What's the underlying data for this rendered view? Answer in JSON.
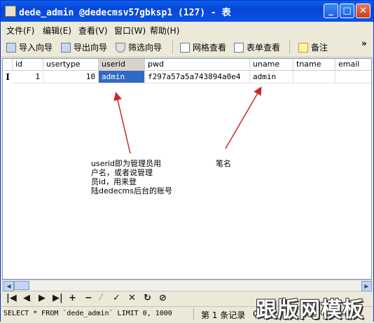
{
  "window": {
    "title": "dede_admin @dedecmsv57gbksp1 (127) - 表",
    "controls": [
      "minimize",
      "maximize",
      "close"
    ]
  },
  "menu": {
    "items": [
      "文件(F)",
      "编辑(E)",
      "查看(V)",
      "窗口(W)",
      "帮助(H)"
    ]
  },
  "toolbar": {
    "import_label": "导入向导",
    "export_label": "导出向导",
    "filter_label": "筛选向导",
    "grid_view_label": "网格查看",
    "form_view_label": "表单查看",
    "memo_label": "备注",
    "overflow": "»"
  },
  "grid": {
    "columns": [
      "id",
      "usertype",
      "userid",
      "pwd",
      "uname",
      "tname",
      "email"
    ],
    "selected_column": "userid",
    "row_indicator": "I",
    "rows": [
      {
        "id": "1",
        "usertype": "10",
        "userid": "admin",
        "pwd": "f297a57a5a743894a0e4",
        "uname": "admin",
        "tname": "",
        "email": ""
      }
    ]
  },
  "annotations": {
    "userid_note_lines": [
      "userid即为管理员用",
      "户名，或者说管理",
      "员id，用来登",
      "陆dedecms后台的账号"
    ],
    "uname_note": "笔名"
  },
  "navigation": {
    "buttons": [
      "first",
      "prev",
      "next",
      "last",
      "add",
      "delete",
      "edit",
      "apply",
      "cancel",
      "refresh",
      "stop"
    ]
  },
  "status": {
    "sql": "SELECT * FROM `dede_admin` LIMIT 0, 1000",
    "record": "第 1 条记录",
    "extra": "G"
  },
  "watermark": "跟版网模板",
  "colors": {
    "titlebar": "#0a5fe8",
    "selection": "#316ac5",
    "arrow": "#c82828"
  }
}
